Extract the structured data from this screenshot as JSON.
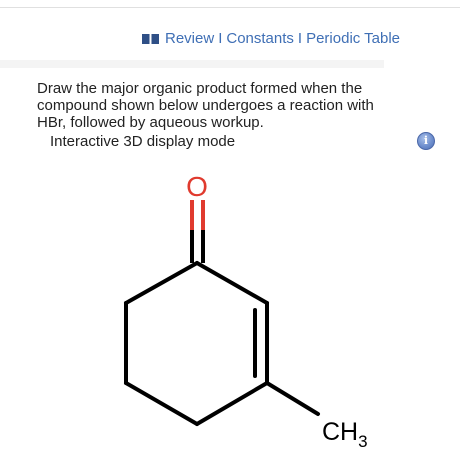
{
  "header": {
    "links": [
      "Review",
      "Constants",
      "Periodic Table"
    ],
    "separator": "I"
  },
  "question": {
    "text": "Draw the major organic product formed when the compound shown below undergoes a reaction with HBr, followed by aqueous workup.",
    "mode_label": "Interactive 3D display mode",
    "info_icon_glyph": "i"
  },
  "molecule": {
    "name_hidden": true,
    "oxygen_label": "O",
    "methyl_label": "CH",
    "methyl_subscript": "3",
    "colors": {
      "oxygen": "#e03a2e",
      "bond": "#000000"
    }
  },
  "colors": {
    "link": "#3f6fb5",
    "text": "#222222",
    "info_button": "#6f8fce"
  }
}
